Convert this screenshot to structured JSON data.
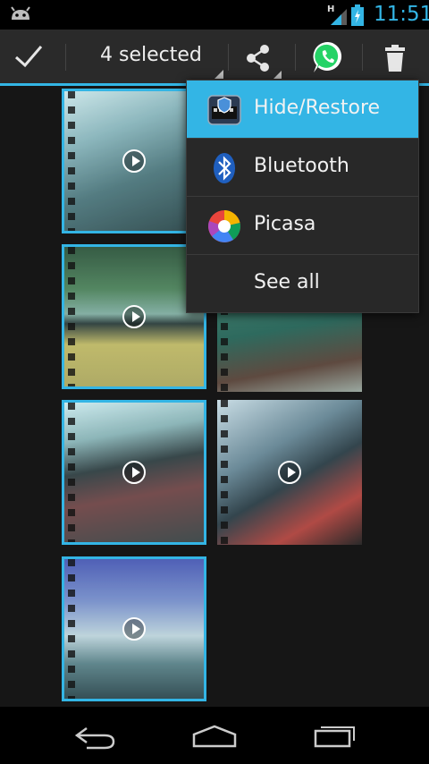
{
  "status": {
    "network": "H",
    "time": "11:51"
  },
  "actionbar": {
    "selected_label": "4 selected"
  },
  "menu": {
    "items": [
      {
        "label": "Hide/Restore",
        "icon": "hide-restore-icon",
        "highlighted": true
      },
      {
        "label": "Bluetooth",
        "icon": "bluetooth-icon"
      },
      {
        "label": "Picasa",
        "icon": "picasa-icon"
      },
      {
        "label": "See all"
      }
    ]
  },
  "gallery": {
    "thumbnails": [
      {
        "selected": true
      },
      {
        "selected": true
      },
      {
        "selected": false
      },
      {
        "selected": true
      },
      {
        "selected": false
      },
      {
        "selected": true
      }
    ]
  },
  "colors": {
    "accent": "#33b5e5",
    "actionbar": "#2a2a2a",
    "menu": "#282828"
  }
}
